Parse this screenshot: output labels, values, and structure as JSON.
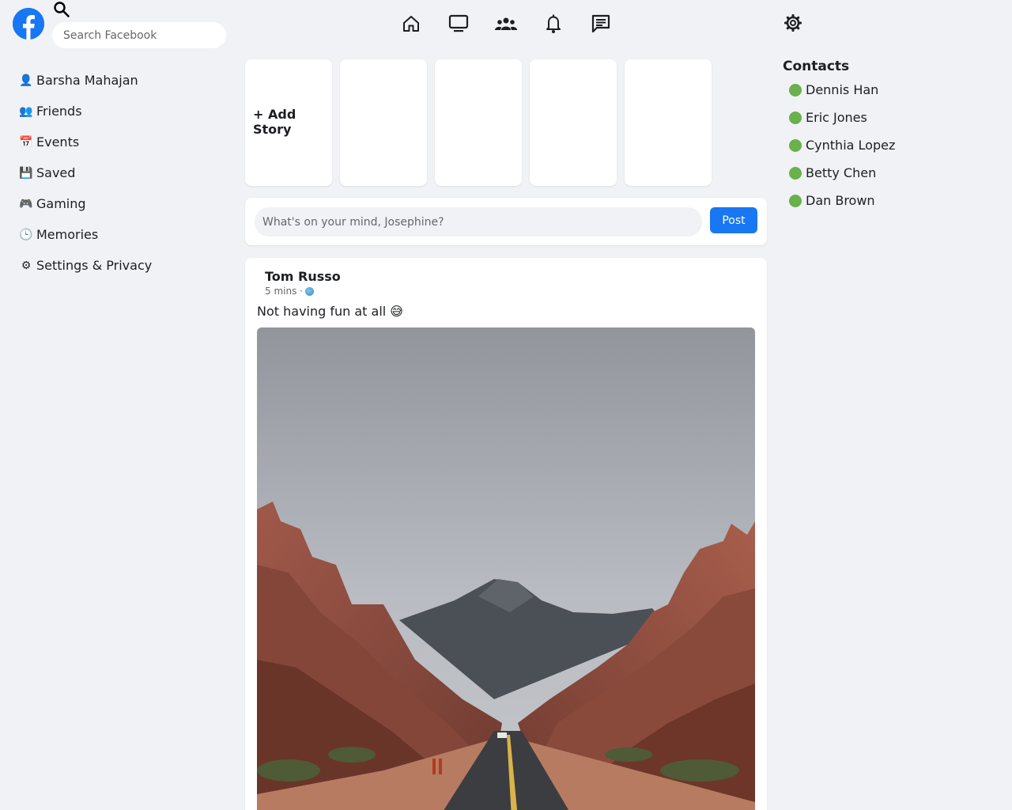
{
  "header": {
    "logo_icon": "facebook-logo",
    "search": {
      "icon": "search-icon",
      "placeholder": "Search Facebook",
      "value": ""
    },
    "nav_icons": [
      "home-icon",
      "watch-icon",
      "groups-icon",
      "notifications-icon",
      "messenger-icon"
    ],
    "settings_icon": "gear-icon",
    "brand_color": "#1877f2"
  },
  "sidebar": {
    "items": [
      {
        "icon": "👤",
        "label": "Barsha Mahajan"
      },
      {
        "icon": "👥",
        "label": "Friends"
      },
      {
        "icon": "📅",
        "label": "Events"
      },
      {
        "icon": "💾",
        "label": "Saved"
      },
      {
        "icon": "🎮",
        "label": "Gaming"
      },
      {
        "icon": "🕒",
        "label": "Memories"
      },
      {
        "icon": "⚙",
        "label": "Settings & Privacy"
      }
    ]
  },
  "stories": {
    "add_label": "+ Add Story",
    "placeholder_count_label": ""
  },
  "composer": {
    "placeholder": "What's on your mind, Josephine?",
    "value": "",
    "post_label": "Post"
  },
  "post": {
    "author": "Tom Russo",
    "time": "5 mins ·",
    "text": "Not having fun at all 😅",
    "image_description_icon": "photo-desert-road"
  },
  "contacts": {
    "title": "Contacts",
    "online_color": "#6ab04c",
    "items": [
      {
        "name": "Dennis Han"
      },
      {
        "name": "Eric Jones"
      },
      {
        "name": "Cynthia Lopez"
      },
      {
        "name": "Betty Chen"
      },
      {
        "name": "Dan Brown"
      }
    ]
  }
}
